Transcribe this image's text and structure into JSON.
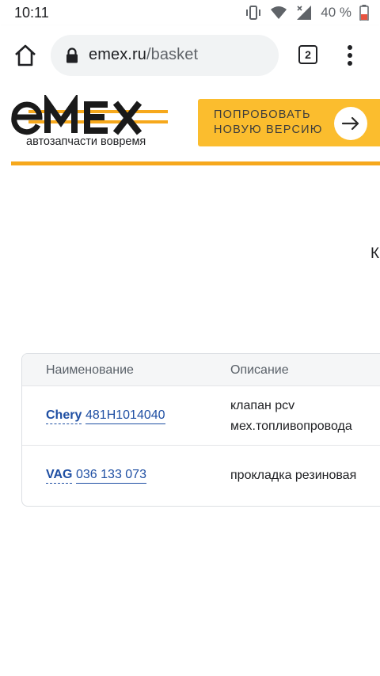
{
  "status_bar": {
    "time": "10:11",
    "battery_percent": "40 %",
    "icons": [
      "vibrate-icon",
      "wifi-icon",
      "signal-icon",
      "battery-icon"
    ]
  },
  "browser": {
    "url_domain": "emex.ru",
    "url_path": "/basket",
    "tab_count": "2",
    "icons": [
      "home-icon",
      "lock-icon",
      "more-vert-icon"
    ]
  },
  "site": {
    "logo_text": "emex",
    "tagline": "автозапчасти вовремя",
    "try_button": "ПОПРОБОВАТЬ НОВУЮ ВЕРСИЮ",
    "cut_text": "К",
    "colors": {
      "accent": "#fbbd2e",
      "line": "#f6a81c",
      "link": "#1f4fa3"
    }
  },
  "table": {
    "columns": [
      "Наименование",
      "Описание"
    ],
    "rows": [
      {
        "brand": "Chery",
        "part_number": "481H1014040",
        "description_line1": "клапан pcv",
        "description_line2": "мех.топливопровода"
      },
      {
        "brand": "VAG",
        "part_number": "036 133 073",
        "description_line1": "прокладка резиновая",
        "description_line2": ""
      }
    ]
  }
}
